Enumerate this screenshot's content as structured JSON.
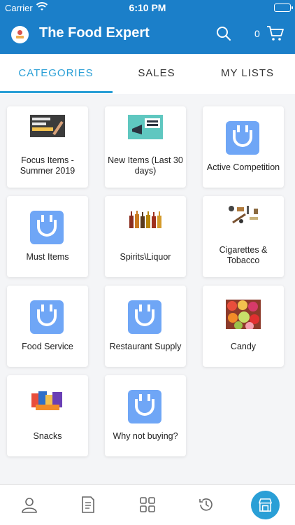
{
  "status_bar": {
    "carrier": "Carrier",
    "time": "6:10 PM"
  },
  "app_bar": {
    "title": "The Food Expert",
    "cart_count": "0"
  },
  "tabs": [
    {
      "label": "CATEGORIES",
      "active": true
    },
    {
      "label": "SALES",
      "active": false
    },
    {
      "label": "MY LISTS",
      "active": false
    }
  ],
  "categories": [
    {
      "label": "Focus Items - Summer 2019",
      "image": "focus-products-image"
    },
    {
      "label": "New Items (Last 30 days)",
      "image": "new-products-megaphone-image"
    },
    {
      "label": "Active Competition",
      "image": "u-logo-icon"
    },
    {
      "label": "Must Items",
      "image": "u-logo-icon"
    },
    {
      "label": "Spirits\\Liquor",
      "image": "liquor-bottles-image"
    },
    {
      "label": "Cigarettes & Tobacco",
      "image": "tobacco-accessories-image"
    },
    {
      "label": "Food Service",
      "image": "u-logo-icon"
    },
    {
      "label": "Restaurant Supply",
      "image": "u-logo-icon"
    },
    {
      "label": "Candy",
      "image": "candy-image"
    },
    {
      "label": "Snacks",
      "image": "snacks-image"
    },
    {
      "label": "Why not buying?",
      "image": "u-logo-icon"
    }
  ],
  "bottom_nav": [
    "profile-icon",
    "invoice-icon",
    "grid-icon",
    "history-icon",
    "store-icon"
  ],
  "colors": {
    "header": "#1b7fc9",
    "accent": "#2a9fd6",
    "u_logo": "#6fa6f6"
  }
}
